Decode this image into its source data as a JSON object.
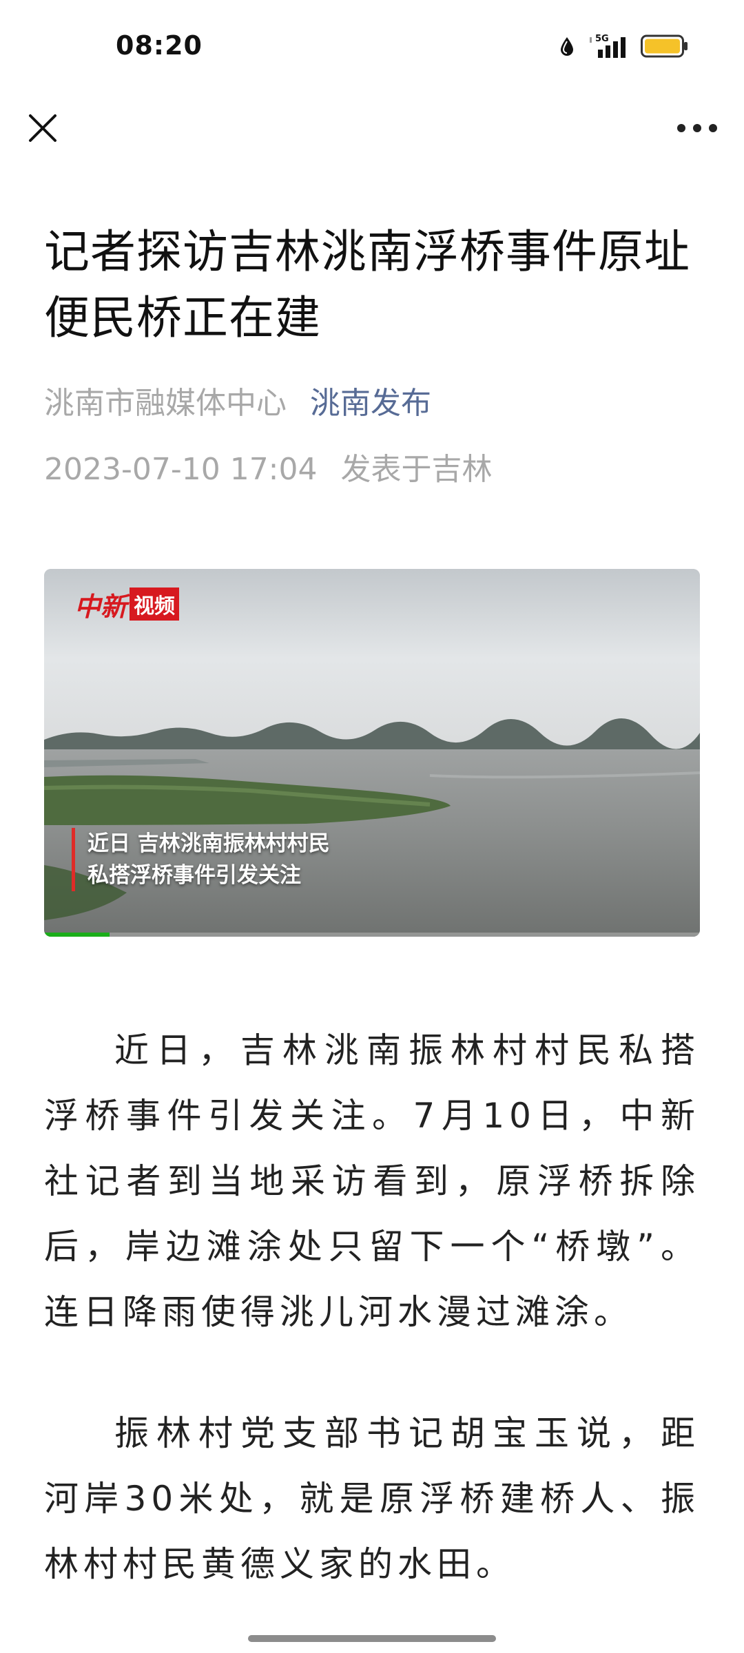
{
  "status_bar": {
    "time": "08:20",
    "network": "5G",
    "icons": [
      "drop-icon",
      "signal-5g-icon",
      "battery-icon"
    ],
    "battery_color": "#f5c229"
  },
  "nav": {
    "close_icon": "close-icon",
    "more_icon": "more-dots-icon"
  },
  "article": {
    "title": "记者探访吉林洮南浮桥事件原址 便民桥正在建",
    "author": "洮南市融媒体中心",
    "account": "洮南发布",
    "datetime": "2023-07-10 17:04",
    "location": "发表于吉林"
  },
  "video": {
    "logo_text_a": "中新",
    "logo_text_b": "视频",
    "caption_line1": "近日 吉林洮南振林村村民",
    "caption_line2": "私搭浮桥事件引发关注",
    "progress": 0.1
  },
  "paragraphs": [
    "近日，吉林洮南振林村村民私搭浮桥事件引发关注。7月10日，中新社记者到当地采访看到，原浮桥拆除后，岸边滩涂处只留下一个“桥墩”。连日降雨使得洮儿河水漫过滩涂。",
    "振林村党支部书记胡宝玉说，距河岸30米处，就是原浮桥建桥人、振林村村民黄德义家的水田。"
  ],
  "colors": {
    "link": "#576b95",
    "meta": "#a8a8a8",
    "caption_bar": "#e02b27",
    "progress": "#1aad19"
  }
}
